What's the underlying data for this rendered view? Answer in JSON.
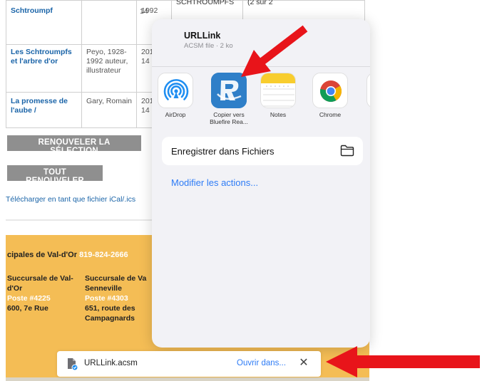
{
  "loans": [
    {
      "title": "Schtroumpf",
      "author": "",
      "date": "1992",
      "date_cont": "14",
      "series": "SCHTROUMPFS",
      "extra": "(2 sur 2"
    },
    {
      "title": "Les Schtroumpfs et l'arbre d'or",
      "author": "Peyo, 1928-1992 auteur, illustrateur",
      "date": "201",
      "date_cont": "14",
      "series": "",
      "extra": ""
    },
    {
      "title": "La promesse de l'aube /",
      "author": "Gary, Romain",
      "date": "201",
      "date_cont": "14",
      "series": "",
      "extra": ""
    }
  ],
  "buttons": {
    "renew_selection": "RENOUVELER LA SÉLECTION",
    "renew_all": "TOUT RENOUVELER"
  },
  "ical_link": "Télécharger en tant que fichier iCal/.ics",
  "footer": {
    "title": "cipales de Val-d'Or",
    "phone": "819-824-2666",
    "branches": [
      {
        "name_line1": "Succursale de Val-",
        "name_line2": "d'Or",
        "poste": "Poste #4225",
        "address_line1": "600, 7e Rue",
        "address_line2": ""
      },
      {
        "name_line1": "Succursale de Va",
        "name_line2": "Senneville",
        "poste": "Poste #4303",
        "address_line1": "651, route des",
        "address_line2": "Campagnards"
      }
    ]
  },
  "share_sheet": {
    "title": "URLLink",
    "subtitle": "ACSM file · 2 ko",
    "apps": [
      {
        "label": "AirDrop",
        "icon": "airdrop-icon"
      },
      {
        "label": "Copier vers Bluefire Rea...",
        "icon": "bluefire-reader-icon"
      },
      {
        "label": "Notes",
        "icon": "notes-icon"
      },
      {
        "label": "Chrome",
        "icon": "chrome-icon"
      }
    ],
    "save_files_label": "Enregistrer dans Fichiers",
    "modify_actions": "Modifier les actions..."
  },
  "download_bar": {
    "filename": "URLLink.acsm",
    "open_in": "Ouvrir dans...",
    "close_symbol": "✕"
  },
  "colors": {
    "link_blue": "#1a64a8",
    "ios_blue": "#2e7cf6",
    "footer_yellow": "#f4bd55",
    "annotation_red": "#e8141a",
    "button_gray": "#8f8f8f"
  }
}
